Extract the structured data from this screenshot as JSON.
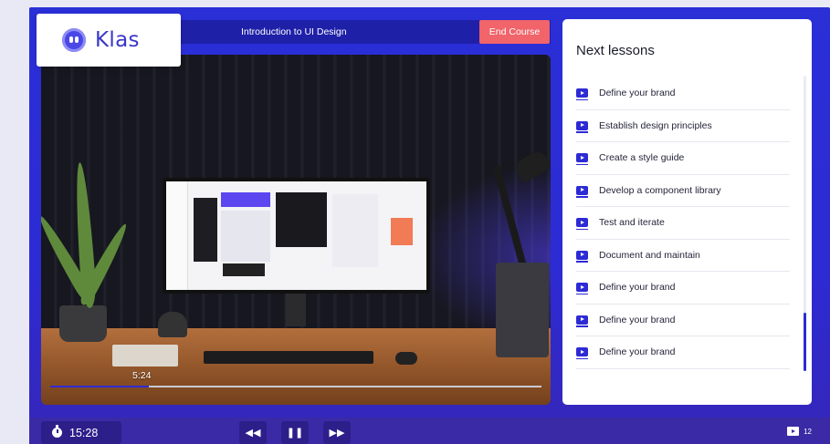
{
  "brand": {
    "name": "Klas"
  },
  "header": {
    "course_title": "Introduction to UI Design",
    "end_course_label": "End Course"
  },
  "player": {
    "current_time": "5:24",
    "progress_fraction": 0.2
  },
  "sidebar": {
    "title": "Next lessons",
    "items": [
      {
        "label": "Define your brand"
      },
      {
        "label": "Establish design principles"
      },
      {
        "label": "Create a style guide"
      },
      {
        "label": "Develop a component library"
      },
      {
        "label": "Test and iterate"
      },
      {
        "label": "Document and maintain"
      },
      {
        "label": "Define your brand"
      },
      {
        "label": "Define your brand"
      },
      {
        "label": "Define your brand"
      }
    ]
  },
  "footer": {
    "timer": "15:28",
    "lesson_count": "12",
    "controls": {
      "rewind": "◀◀",
      "pause": "❚❚",
      "forward": "▶▶"
    }
  },
  "colors": {
    "accent": "#2d2bd4",
    "end_button": "#f0646a",
    "frame": "#2a2fd6"
  }
}
